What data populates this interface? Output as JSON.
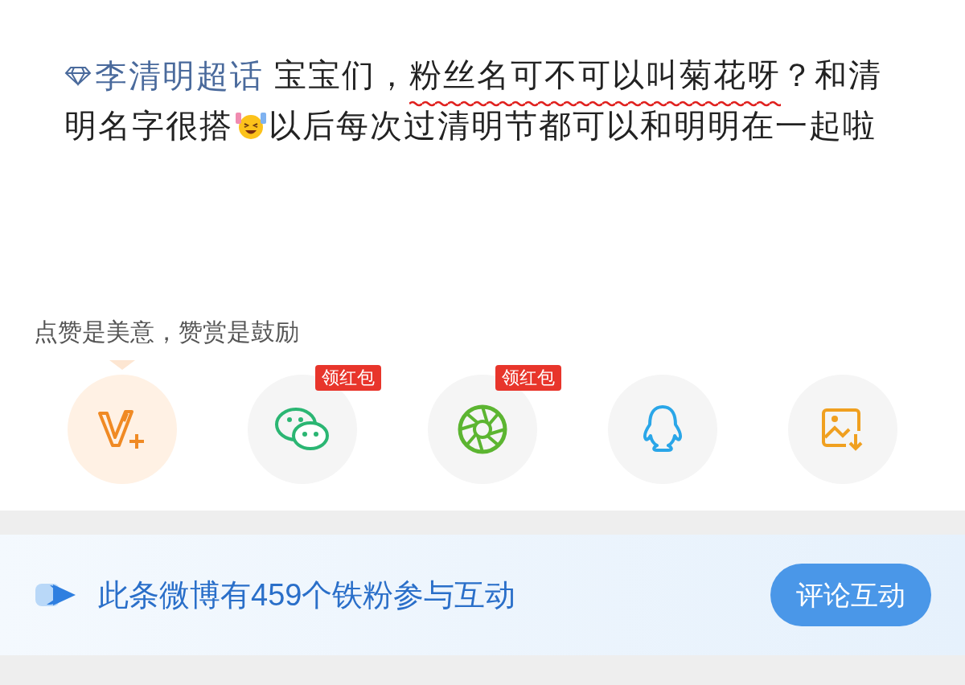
{
  "post": {
    "segments": [
      {
        "kind": "topic",
        "text": "李清明超话",
        "underlined": false
      },
      {
        "kind": "text",
        "text": " 宝宝们，",
        "underlined": false
      },
      {
        "kind": "text",
        "text": "粉丝名可不可以叫菊花呀",
        "underlined": true
      },
      {
        "kind": "text",
        "text": "？和清明名字很搭",
        "underlined": false
      },
      {
        "kind": "emoji"
      },
      {
        "kind": "text",
        "text": "以后每次过清明节都可以和明明在一起啦",
        "underlined": false
      }
    ]
  },
  "reward_tip": "点赞是美意，赞赏是鼓励",
  "share_buttons": [
    {
      "kind": "reward",
      "selected": true
    },
    {
      "kind": "wechat",
      "selected": false,
      "badge": "领红包"
    },
    {
      "kind": "moments",
      "selected": false,
      "badge": "领红包"
    },
    {
      "kind": "qq",
      "selected": false
    },
    {
      "kind": "save",
      "selected": false
    }
  ],
  "banner": {
    "text": "此条微博有459个铁粉参与互动",
    "button": "评论互动"
  }
}
